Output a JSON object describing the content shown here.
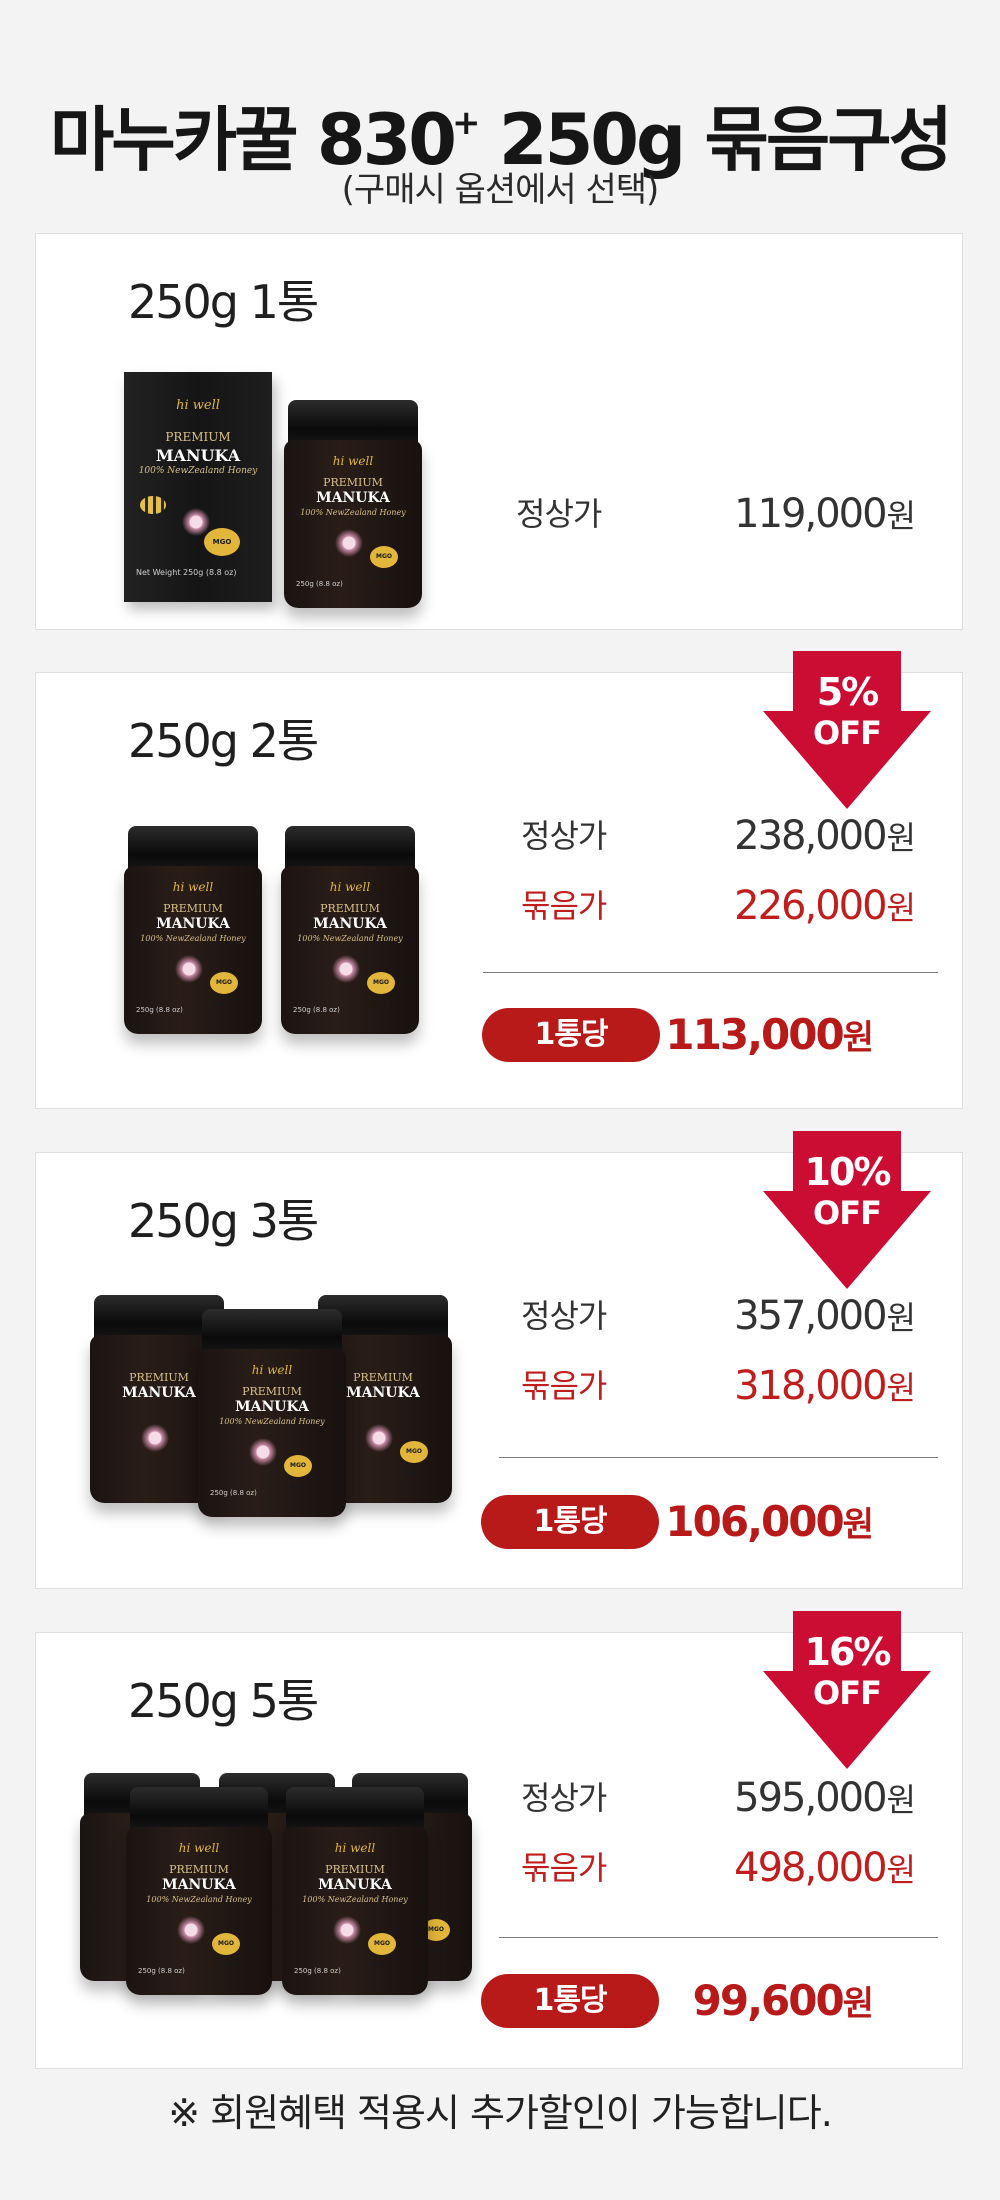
{
  "header": {
    "title_main": "마누카꿀 830",
    "title_sup": "+",
    "title_rest": " 250g 묶음구성",
    "subtitle": "(구매시 옵션에서 선택)"
  },
  "product": {
    "brand": "hi well",
    "line1": "PREMIUM",
    "line2": "MANUKA",
    "line3": "100% NewZealand Honey",
    "badge": "MGO 830+",
    "weight": "250g (8.8 oz)",
    "box_weight": "Net Weight 250g (8.8 oz)"
  },
  "labels": {
    "regular": "정상가",
    "bundle": "묶음가",
    "per_unit": "1통당",
    "won": "원",
    "off": "OFF"
  },
  "options": [
    {
      "title": "250g 1통",
      "regular": "119,000"
    },
    {
      "title": "250g 2통",
      "discount": "5%",
      "regular": "238,000",
      "bundle": "226,000",
      "per_unit": "113,000"
    },
    {
      "title": "250g 3통",
      "discount": "10%",
      "regular": "357,000",
      "bundle": "318,000",
      "per_unit": "106,000"
    },
    {
      "title": "250g 5통",
      "discount": "16%",
      "regular": "595,000",
      "bundle": "498,000",
      "per_unit": "99,600"
    }
  ],
  "colors": {
    "accent_red": "#b81a1a",
    "discount_red": "#cc0d33",
    "background": "#f3f3f3"
  },
  "footnote": "※ 회원혜택 적용시 추가할인이 가능합니다."
}
